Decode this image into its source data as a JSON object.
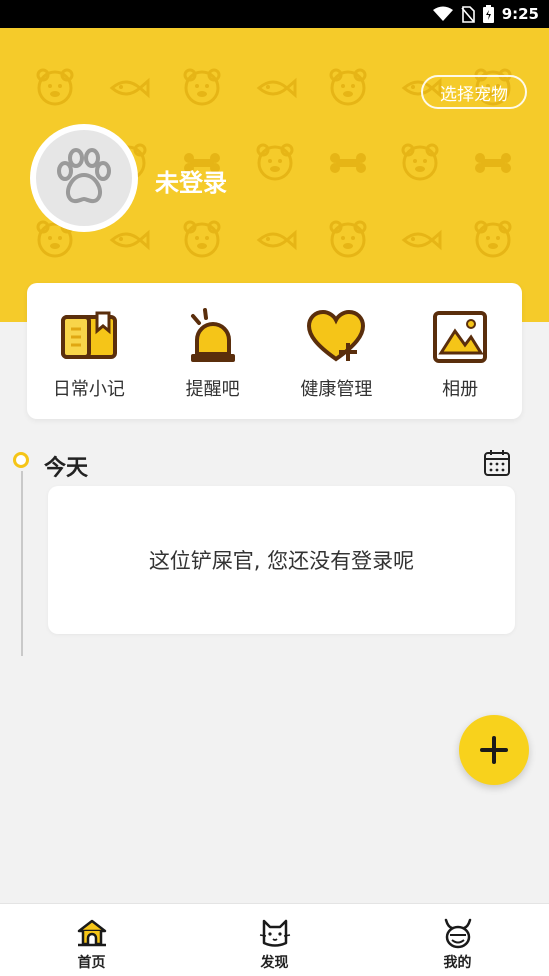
{
  "status_bar": {
    "time": "9:25",
    "icons": [
      "wifi-icon",
      "no-sim-icon",
      "battery-icon"
    ]
  },
  "header": {
    "select_pet_label": "选择宠物",
    "username": "未登录",
    "background_color": "#f5cb2a",
    "avatar_icon": "paw-icon"
  },
  "quick_actions": [
    {
      "label": "日常小记",
      "icon": "diary-book-icon"
    },
    {
      "label": "提醒吧",
      "icon": "alarm-light-icon"
    },
    {
      "label": "健康管理",
      "icon": "heart-plus-icon"
    },
    {
      "label": "相册",
      "icon": "photo-album-icon"
    }
  ],
  "timeline": {
    "today_label": "今天",
    "calendar_icon": "calendar-icon",
    "empty_message": "这位铲屎官, 您还没有登录呢"
  },
  "fab": {
    "icon": "plus-icon",
    "color": "#f8d21c"
  },
  "bottom_nav": [
    {
      "label": "首页",
      "icon": "home-kennel-icon"
    },
    {
      "label": "发现",
      "icon": "cat-face-icon"
    },
    {
      "label": "我的",
      "icon": "pet-head-icon"
    }
  ]
}
